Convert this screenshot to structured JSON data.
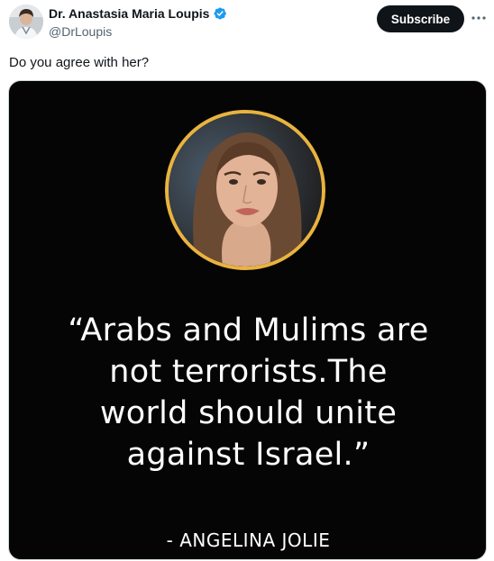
{
  "post": {
    "author_name": "Dr. Anastasia Maria Loupis",
    "author_handle": "@DrLoupis",
    "subscribe_label": "Subscribe",
    "more_icon": "more-horizontal-icon",
    "verified_icon": "verified-badge-icon",
    "text": "Do you agree with her?"
  },
  "media": {
    "quote_lines": [
      "“Arabs and Mulims are",
      "not terrorists.The",
      "world should unite",
      "against Israel.”"
    ],
    "attribution": "- ANGELINA JOLIE"
  },
  "colors": {
    "verified": "#1d9bf0",
    "subscribe_bg": "#0f1419",
    "ring": "#e9b33f",
    "media_bg": "#050505"
  }
}
